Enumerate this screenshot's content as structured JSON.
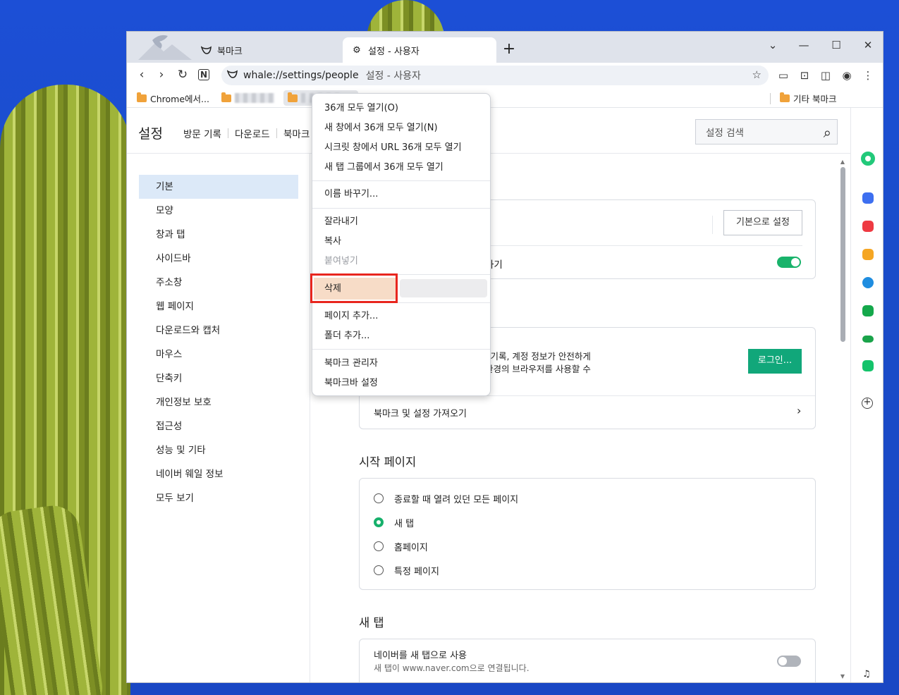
{
  "tabs": [
    {
      "label": "북마크",
      "icon": "whale-icon"
    },
    {
      "label": "설정 - 사용자",
      "icon": "gear-icon"
    }
  ],
  "newtab": "+",
  "window_controls": [
    "⌄",
    "—",
    "☐",
    "✕"
  ],
  "omnibox": {
    "url": "whale://settings/people",
    "title": "설정 - 사용자"
  },
  "bookmarks": {
    "items": [
      "Chrome에서...",
      "",
      ""
    ],
    "other": "기타 북마크"
  },
  "header": {
    "title": "설정",
    "links": [
      "방문 기록",
      "다운로드",
      "북마크"
    ],
    "search_placeholder": "설정 검색"
  },
  "nav": [
    "기본",
    "모양",
    "창과 탭",
    "사이드바",
    "주소창",
    "웹 페이지",
    "다운로드와 캡처",
    "마우스",
    "단축키",
    "개인정보 보호",
    "접근성",
    "성능 및 기타",
    "네이버 웨일 정보",
    "모두 보기"
  ],
  "content": {
    "default_button": "기본으로 설정",
    "row2_tail": "하기",
    "login_text_1": "문 기록, 계정 정보가 안전하게",
    "login_text_2": "· 환경의 브라우저를 사용할 수",
    "login_button": "로그인...",
    "import_row": "북마크 및 설정 가져오기",
    "startup_title": "시작 페이지",
    "startup_options": [
      "종료할 때 열려 있던 모든 페이지",
      "새 탭",
      "홈페이지",
      "특정 페이지"
    ],
    "newtab_title": "새 탭",
    "naver_row": "네이버를 새 탭으로 사용",
    "naver_sub": "새 탭이 www.naver.com으로 연결됩니다."
  },
  "context_menu": {
    "items": [
      "36개 모두 열기(O)",
      "새 창에서 36개 모두 열기(N)",
      "시크릿 창에서 URL 36개 모두 열기",
      "새 탭 그룹에서 36개 모두 열기",
      "이름 바꾸기...",
      "잘라내기",
      "복사",
      "붙여넣기",
      "삭제",
      "페이지 추가...",
      "폴더 추가...",
      "북마크 관리자",
      "북마크바 설정"
    ]
  },
  "colors": {
    "accent_green": "#11a77a",
    "highlight_red": "#e8261e",
    "nav_selected": "#dce9f8"
  }
}
